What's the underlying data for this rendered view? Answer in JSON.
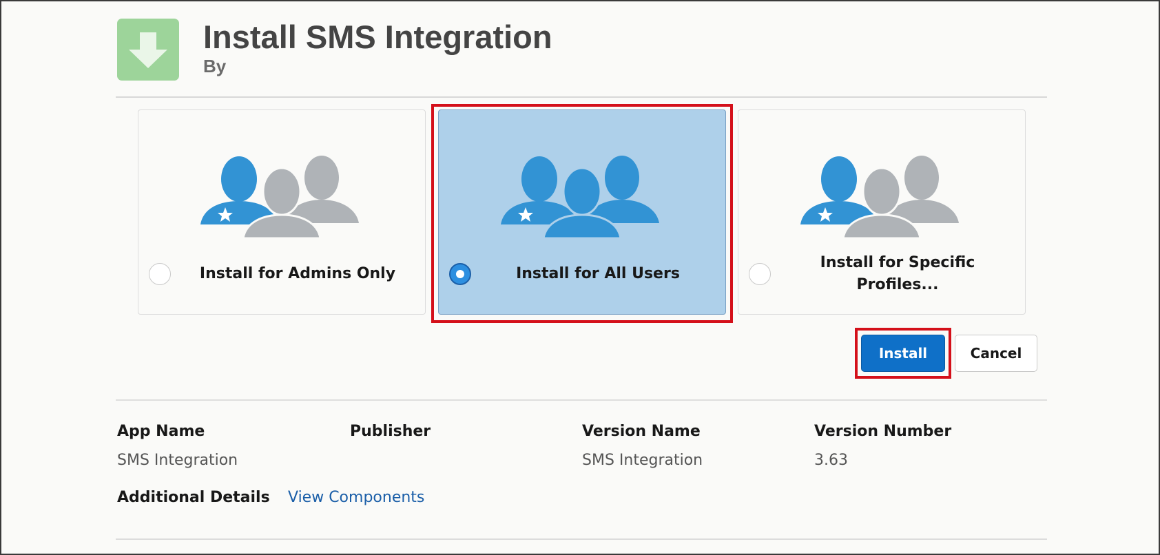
{
  "header": {
    "title": "Install SMS Integration",
    "byline": "By",
    "icon": "download-arrow-icon",
    "icon_bg": "#9dd49a"
  },
  "options": [
    {
      "label": "Install for Admins Only",
      "selected": false,
      "icon": "admin-users-icon"
    },
    {
      "label": "Install for All Users",
      "selected": true,
      "icon": "all-users-icon"
    },
    {
      "label": "Install for Specific Profiles...",
      "selected": false,
      "icon": "specific-profiles-users-icon"
    }
  ],
  "actions": {
    "install_label": "Install",
    "cancel_label": "Cancel"
  },
  "details": {
    "app_name_label": "App Name",
    "app_name_value": "SMS Integration",
    "publisher_label": "Publisher",
    "publisher_value": "",
    "version_name_label": "Version Name",
    "version_name_value": "SMS Integration",
    "version_number_label": "Version Number",
    "version_number_value": "3.63",
    "additional_label": "Additional Details",
    "view_components_link": "View Components"
  },
  "colors": {
    "accent_blue": "#0f70c8",
    "selected_tile": "#aed0ea",
    "highlight_red": "#d4101a",
    "link_blue": "#1a5ea8"
  }
}
